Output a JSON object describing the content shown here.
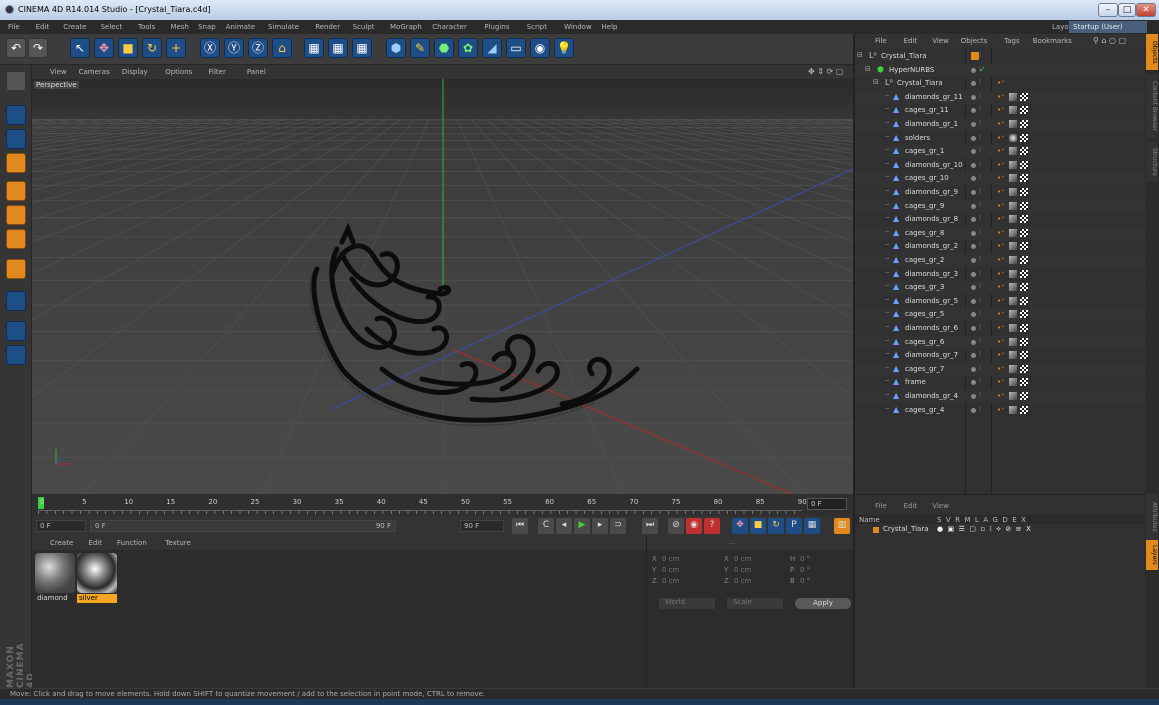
{
  "window": {
    "title": "CINEMA 4D R14.014 Studio - [Crystal_Tiara.c4d]"
  },
  "menu": [
    "File",
    "Edit",
    "Create",
    "Select",
    "Tools",
    "Mesh",
    "Snap",
    "Animate",
    "Simulate",
    "Render",
    "Sculpt",
    "MoGraph",
    "Character",
    "Plugins",
    "Script",
    "Window",
    "Help"
  ],
  "layout": {
    "label": "Layout:",
    "value": "Startup (User)"
  },
  "viewport": {
    "menu": [
      "View",
      "Cameras",
      "Display",
      "Options",
      "Filter",
      "Panel"
    ],
    "label": "Perspective"
  },
  "timeline": {
    "ticks": [
      "0",
      "5",
      "10",
      "15",
      "20",
      "25",
      "30",
      "35",
      "40",
      "45",
      "50",
      "55",
      "60",
      "65",
      "70",
      "75",
      "80",
      "85",
      "90"
    ],
    "current_frame": "0 F",
    "start_field": "0 F",
    "range_start": "0 F",
    "range_end": "90 F",
    "end_field": "90 F"
  },
  "material_manager": {
    "menu": [
      "Create",
      "Edit",
      "Function",
      "Texture"
    ],
    "materials": [
      {
        "name": "diamond",
        "selected": false
      },
      {
        "name": "silver",
        "selected": true
      }
    ]
  },
  "coordinates": {
    "rows": [
      {
        "a": "X",
        "av": "0 cm",
        "b": "X",
        "bv": "0 cm",
        "c": "H",
        "cv": "0 °"
      },
      {
        "a": "Y",
        "av": "0 cm",
        "b": "Y",
        "bv": "0 cm",
        "c": "P",
        "cv": "0 °"
      },
      {
        "a": "Z",
        "av": "0 cm",
        "b": "Z",
        "bv": "0 cm",
        "c": "B",
        "cv": "0 °"
      }
    ],
    "mode": "World",
    "scale_mode": "Scale",
    "apply": "Apply"
  },
  "object_manager": {
    "menu": [
      "File",
      "Edit",
      "View",
      "Objects",
      "Tags",
      "Bookmarks"
    ],
    "items": [
      {
        "name": "Crystal_Tiara",
        "level": 0,
        "type": "null"
      },
      {
        "name": "HyperNURBS",
        "level": 1,
        "type": "nurbs"
      },
      {
        "name": "Crystal_Tiara",
        "level": 2,
        "type": "null"
      },
      {
        "name": "diamonds_gr_11",
        "level": 3,
        "type": "mesh"
      },
      {
        "name": "cages_gr_11",
        "level": 3,
        "type": "mesh"
      },
      {
        "name": "diamonds_gr_1",
        "level": 3,
        "type": "mesh"
      },
      {
        "name": "solders",
        "level": 3,
        "type": "mesh"
      },
      {
        "name": "cages_gr_1",
        "level": 3,
        "type": "mesh"
      },
      {
        "name": "diamonds_gr_10",
        "level": 3,
        "type": "mesh"
      },
      {
        "name": "cages_gr_10",
        "level": 3,
        "type": "mesh"
      },
      {
        "name": "diamonds_gr_9",
        "level": 3,
        "type": "mesh"
      },
      {
        "name": "cages_gr_9",
        "level": 3,
        "type": "mesh"
      },
      {
        "name": "diamonds_gr_8",
        "level": 3,
        "type": "mesh"
      },
      {
        "name": "cages_gr_8",
        "level": 3,
        "type": "mesh"
      },
      {
        "name": "diamonds_gr_2",
        "level": 3,
        "type": "mesh"
      },
      {
        "name": "cages_gr_2",
        "level": 3,
        "type": "mesh"
      },
      {
        "name": "diamonds_gr_3",
        "level": 3,
        "type": "mesh"
      },
      {
        "name": "cages_gr_3",
        "level": 3,
        "type": "mesh"
      },
      {
        "name": "diamonds_gr_5",
        "level": 3,
        "type": "mesh"
      },
      {
        "name": "cages_gr_5",
        "level": 3,
        "type": "mesh"
      },
      {
        "name": "diamonds_gr_6",
        "level": 3,
        "type": "mesh"
      },
      {
        "name": "cages_gr_6",
        "level": 3,
        "type": "mesh"
      },
      {
        "name": "diamonds_gr_7",
        "level": 3,
        "type": "mesh"
      },
      {
        "name": "cages_gr_7",
        "level": 3,
        "type": "mesh"
      },
      {
        "name": "frame",
        "level": 3,
        "type": "mesh"
      },
      {
        "name": "diamonds_gr_4",
        "level": 3,
        "type": "mesh"
      },
      {
        "name": "cages_gr_4",
        "level": 3,
        "type": "mesh"
      }
    ]
  },
  "layer_manager": {
    "menu": [
      "File",
      "Edit",
      "View"
    ],
    "header": {
      "name": "Name",
      "flags": "S  V  R  M  L  A  G  D  E  X"
    },
    "layers": [
      {
        "name": "Crystal_Tiara"
      }
    ]
  },
  "side_tabs": [
    "Objects",
    "Content Browser",
    "Structure",
    "Attributes",
    "Layers"
  ],
  "status": "Move: Click and drag to move elements. Hold down SHIFT to quantize movement / add to the selection in point mode, CTRL to remove.",
  "branding": "MAXON CINEMA 4D",
  "colors": {
    "accent": "#e08a1e",
    "toolbar_blue": "#1f4d86",
    "selection": "#f5a623"
  }
}
